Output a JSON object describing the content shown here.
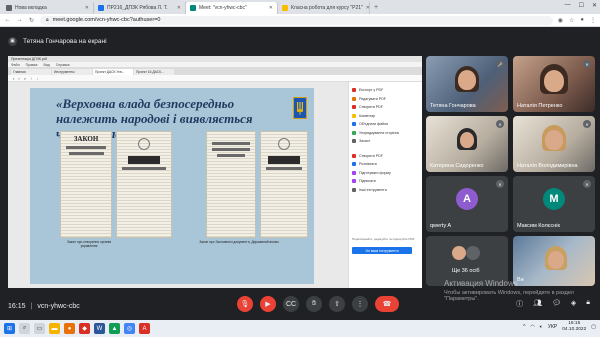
{
  "browser": {
    "tabs": [
      {
        "title": "Нова вкладка",
        "color": "#5f6368",
        "active": false
      },
      {
        "title": "ПР216_ДПЗК Рябова Л. Т.",
        "color": "#1a73e8",
        "active": false
      },
      {
        "title": "Meet: \"vcn-yhwc-cbc\"",
        "color": "#00897b",
        "active": true
      },
      {
        "title": "Класна робота для курсу \"Р21\"",
        "color": "#fbbc04",
        "active": false
      }
    ],
    "url": "meet.google.com/vcn-yhwc-cbc?authuser=0"
  },
  "presenter_label": "Тетяна Гончарова на екрані",
  "shared": {
    "window_title": "Презентація ДПЗК.pdf",
    "menu": [
      "Файл",
      "Правка",
      "Вид",
      "Справка"
    ],
    "doc_tabs": [
      "Главная",
      "Инструменты",
      "Проект ДАСК Ухв...",
      "Проект 16 ДАСК..."
    ],
    "slide_title": "«Верховна влада безпосередньо належить народові і виявляється через парламент...»",
    "doc1_title": "ЗАКОН",
    "caption_1": "Закон про створення органів управління",
    "caption_2": "Закон про Засновничі документи, Державний вісник",
    "panel_items": [
      "Експорт у PDF",
      "Редагувати PDF",
      "Створити PDF",
      "Коментар",
      "Об'єднати файли",
      "Упорядкування сторінок",
      "Захист",
      "Створити PDF",
      "Розпізнати",
      "Підготувати форму",
      "Підписати",
      "Інші інструменти"
    ],
    "panel_button": "Усі ваші інструменти",
    "panel_note": "Перетворюйте, редагуйте та підписуйте PDF"
  },
  "participants": [
    {
      "name": "Тетяна Гончарова"
    },
    {
      "name": "Наталія Петренко"
    },
    {
      "name": "Катерина Сидоренко"
    },
    {
      "name": "Наталія Володимирівна"
    },
    {
      "name": "qwerty A",
      "initial": "A"
    },
    {
      "name": "Максим Колєснік",
      "initial": "M"
    },
    {
      "name": "Ще 36 осіб"
    },
    {
      "name": "Ви"
    }
  ],
  "bottom": {
    "time": "16:15",
    "code": "vcn-yhwc-cbc"
  },
  "watermark": {
    "line1": "Активация Windows",
    "line2": "Чтобы активировать Windows, перейдите в раздел \"Параметры\"."
  },
  "taskbar": {
    "lang": "УКР",
    "time": "16:15",
    "date": "04.10.2022"
  },
  "colors": {
    "meet_bg": "#202124",
    "end_call": "#ea4335",
    "slide_bg": "#a9c6d8",
    "avatar_a": "#8e5ccf",
    "avatar_m": "#00897b"
  }
}
